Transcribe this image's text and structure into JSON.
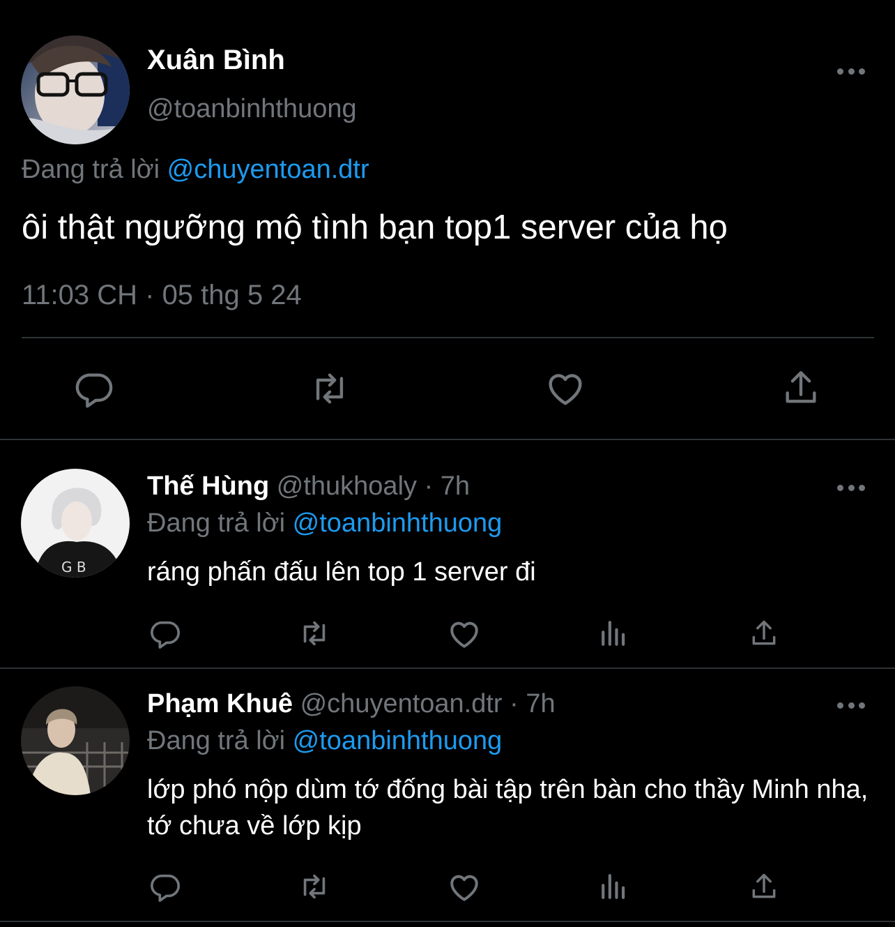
{
  "main_tweet": {
    "author_name": "Xuân Bình",
    "author_handle": "@toanbinhthuong",
    "replying_to_label": "Đang trả lời",
    "replying_to_handle": "@chuyentoan.dtr",
    "text": "ôi thật ngưỡng mộ tình bạn top1 server của họ",
    "timestamp": "11:03 CH · 05 thg 5 24",
    "actions": [
      "reply-icon",
      "retweet-icon",
      "like-icon",
      "share-icon"
    ]
  },
  "replies": [
    {
      "author_name": "Thế Hùng",
      "author_handle": "@thukhoaly",
      "time_ago": "· 7h",
      "replying_to_label": "Đang trả lời",
      "replying_to_handle": "@toanbinhthuong",
      "text": "ráng phấn đấu lên top 1 server đi",
      "actions": [
        "reply-icon",
        "retweet-icon",
        "like-icon",
        "views-icon",
        "share-icon"
      ]
    },
    {
      "author_name": "Phạm Khuê",
      "author_handle": "@chuyentoan.dtr",
      "time_ago": "· 7h",
      "replying_to_label": "Đang trả lời",
      "replying_to_handle": "@toanbinhthuong",
      "text": "lớp phó nộp dùm tớ đống bài tập trên bàn cho thầy Minh nha, tớ chưa về lớp kịp",
      "actions": [
        "reply-icon",
        "retweet-icon",
        "like-icon",
        "views-icon",
        "share-icon"
      ]
    }
  ],
  "colors": {
    "background": "#000000",
    "secondary_text": "#71767b",
    "mention": "#1d9bf0",
    "divider": "#2f3336"
  }
}
